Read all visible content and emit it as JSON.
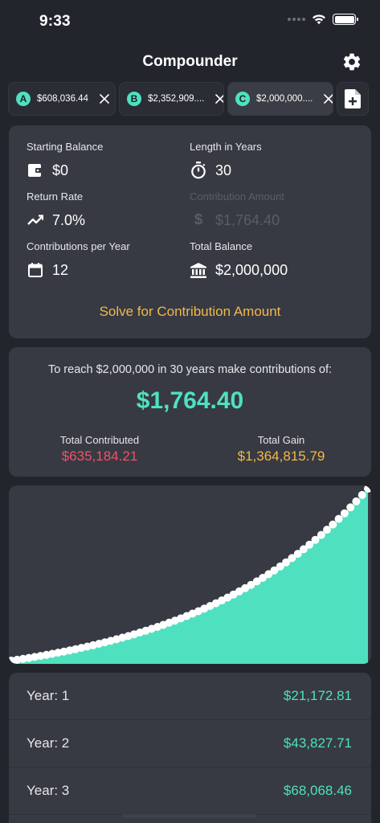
{
  "status": {
    "time": "9:33"
  },
  "nav": {
    "title": "Compounder"
  },
  "tabs": [
    {
      "badge": "A",
      "label": "$608,036.44"
    },
    {
      "badge": "B",
      "label": "$2,352,909...."
    },
    {
      "badge": "C",
      "label": "$2,000,000....",
      "active": true
    }
  ],
  "inputs": {
    "starting_balance": {
      "label": "Starting Balance",
      "value": "$0"
    },
    "length_years": {
      "label": "Length in Years",
      "value": "30"
    },
    "return_rate": {
      "label": "Return Rate",
      "value": "7.0%"
    },
    "contribution_amount": {
      "label": "Contribution Amount",
      "value": "$1,764.40"
    },
    "contributions_per_year": {
      "label": "Contributions per Year",
      "value": "12"
    },
    "total_balance": {
      "label": "Total Balance",
      "value": "$2,000,000"
    },
    "solve_label": "Solve for Contribution Amount"
  },
  "result": {
    "intro": "To reach $2,000,000 in 30 years make contributions of:",
    "amount": "$1,764.40",
    "total_contributed_label": "Total Contributed",
    "total_contributed": "$635,184.21",
    "total_gain_label": "Total Gain",
    "total_gain": "$1,364,815.79"
  },
  "chart_data": {
    "type": "area",
    "x": [
      0,
      1,
      2,
      3,
      4,
      5,
      6,
      7,
      8,
      9,
      10,
      11,
      12,
      13,
      14,
      15,
      16,
      17,
      18,
      19,
      20,
      21,
      22,
      23,
      24,
      25,
      26,
      27,
      28,
      29,
      30
    ],
    "values": [
      0,
      21172.81,
      43827.71,
      68068.46,
      94006.15,
      121759.47,
      151455.52,
      183230.27,
      217229.22,
      253608.18,
      292534.13,
      334185.0,
      378750.46,
      426435.25,
      477458.33,
      532053.07,
      590469.43,
      652974.98,
      719855.8,
      791418.33,
      867990.79,
      949924.06,
      1037592.7,
      1131398.02,
      1231769.64,
      1339167.25,
      1454082.92,
      1577043.38,
      1708612.99,
      1849392.85,
      2000000
    ],
    "colors": {
      "fill": "#4fe0c0",
      "marker": "#ffffff"
    }
  },
  "years": [
    {
      "label": "Year: 1",
      "value": "$21,172.81"
    },
    {
      "label": "Year: 2",
      "value": "$43,827.71"
    },
    {
      "label": "Year: 3",
      "value": "$68,068.46"
    }
  ],
  "colors": {
    "background": "#22252c",
    "card": "#373a42",
    "accent": "#4fe0c0",
    "warning": "#f2b84b",
    "negative": "#f0526a"
  }
}
